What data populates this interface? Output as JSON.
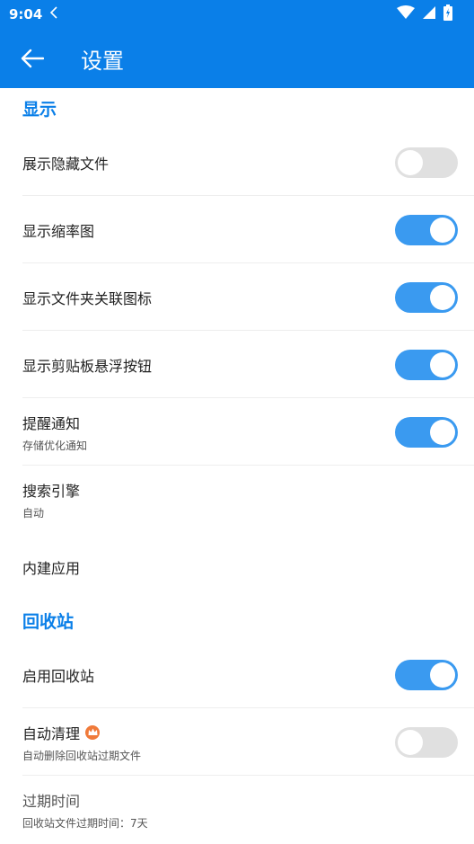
{
  "status_bar": {
    "time": "9:04"
  },
  "app_bar": {
    "title": "设置"
  },
  "sections": {
    "display": {
      "header": "显示",
      "items": [
        {
          "label": "展示隐藏文件",
          "toggle": "off"
        },
        {
          "label": "显示缩率图",
          "toggle": "on"
        },
        {
          "label": "显示文件夹关联图标",
          "toggle": "on"
        },
        {
          "label": "显示剪贴板悬浮按钮",
          "toggle": "on"
        },
        {
          "label": "提醒通知",
          "subtitle": "存储优化通知",
          "toggle": "on"
        },
        {
          "label": "搜索引擎",
          "subtitle": "自动"
        },
        {
          "label": "内建应用"
        }
      ]
    },
    "recycle_bin": {
      "header": "回收站",
      "items": [
        {
          "label": "启用回收站",
          "toggle": "on"
        },
        {
          "label": "自动清理",
          "subtitle": "自动删除回收站过期文件",
          "toggle": "off",
          "badge_icon": "crown-icon"
        },
        {
          "label": "过期时间",
          "subtitle": "回收站文件过期时间：7天"
        }
      ]
    }
  },
  "colors": {
    "primary": "#0a7fe8",
    "toggle_on": "#3a9af0",
    "toggle_off": "#e0e0e0",
    "badge": "#f07a3a"
  }
}
